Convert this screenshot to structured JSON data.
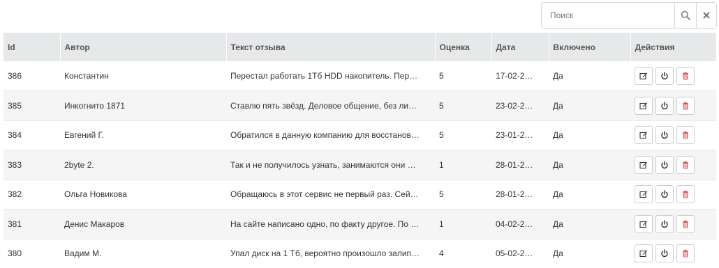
{
  "search": {
    "placeholder": "Поиск",
    "search_icon": "search-icon",
    "clear_icon": "close-icon"
  },
  "columns": [
    "Id",
    "Автор",
    "Текст отзыва",
    "Оценка",
    "Дата",
    "Включено",
    "Действия"
  ],
  "rows": [
    {
      "id": "386",
      "author": "Константин",
      "text": "Перестал работать 1Тб HDD накопитель. Пер…",
      "rating": "5",
      "date": "17-02-2…",
      "enabled": "Да"
    },
    {
      "id": "385",
      "author": "Инкогнито 1871",
      "text": "Ставлю пять звёзд. Деловое общение, без ли…",
      "rating": "5",
      "date": "23-02-2…",
      "enabled": "Да"
    },
    {
      "id": "384",
      "author": "Евгений Г.",
      "text": "Обратился в данную компанию для восстанов…",
      "rating": "5",
      "date": "23-01-2…",
      "enabled": "Да"
    },
    {
      "id": "383",
      "author": "2byte 2.",
      "text": "Так и не получилось узнать, занимаются они …",
      "rating": "1",
      "date": "28-01-2…",
      "enabled": "Да"
    },
    {
      "id": "382",
      "author": "Ольга Новикова",
      "text": "Обращаюсь в этот сервис не первый раз. Сей…",
      "rating": "5",
      "date": "28-01-2…",
      "enabled": "Да"
    },
    {
      "id": "381",
      "author": "Денис Макаров",
      "text": "На сайте написано одно, по факту другое. По …",
      "rating": "1",
      "date": "04-02-2…",
      "enabled": "Да"
    },
    {
      "id": "380",
      "author": "Вадим М.",
      "text": "Упал диск на 1 Тб, вероятно произошло залип…",
      "rating": "4",
      "date": "05-02-2…",
      "enabled": "Да"
    }
  ],
  "actions": {
    "edit_icon": "edit-icon",
    "toggle_icon": "power-icon",
    "delete_icon": "trash-icon"
  },
  "colors": {
    "enabled": "#5cb85c",
    "delete": "#d9534f",
    "header_bg": "#e6e8ea",
    "stripe": "#f5f5f5"
  }
}
